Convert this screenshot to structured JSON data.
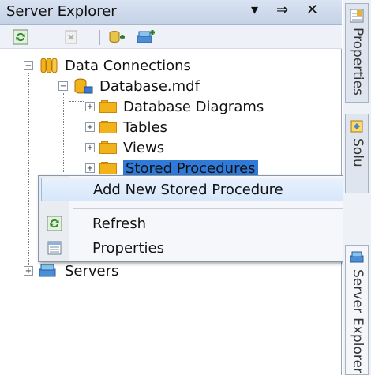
{
  "panel": {
    "title": "Server Explorer",
    "controls": {
      "dropdown": "▾",
      "pin": "⇒",
      "close": "✕"
    }
  },
  "toolbar": {
    "buttons": [
      "refresh-icon",
      "stop-icon",
      "connect-database-icon",
      "connect-server-icon"
    ]
  },
  "tree": {
    "data_connections": "Data Connections",
    "database": "Database.mdf",
    "children": [
      "Database Diagrams",
      "Tables",
      "Views",
      "Stored Procedures"
    ],
    "servers": "Servers"
  },
  "context_menu": {
    "items": [
      "Add New Stored Procedure",
      "Refresh",
      "Properties"
    ]
  },
  "side_tabs": [
    "Properties",
    "Solu",
    "Server Explorer"
  ],
  "colors": {
    "selection": "#2f7ad8",
    "folder": "#f2b21a",
    "menu_highlight": "#d7e7fb"
  }
}
